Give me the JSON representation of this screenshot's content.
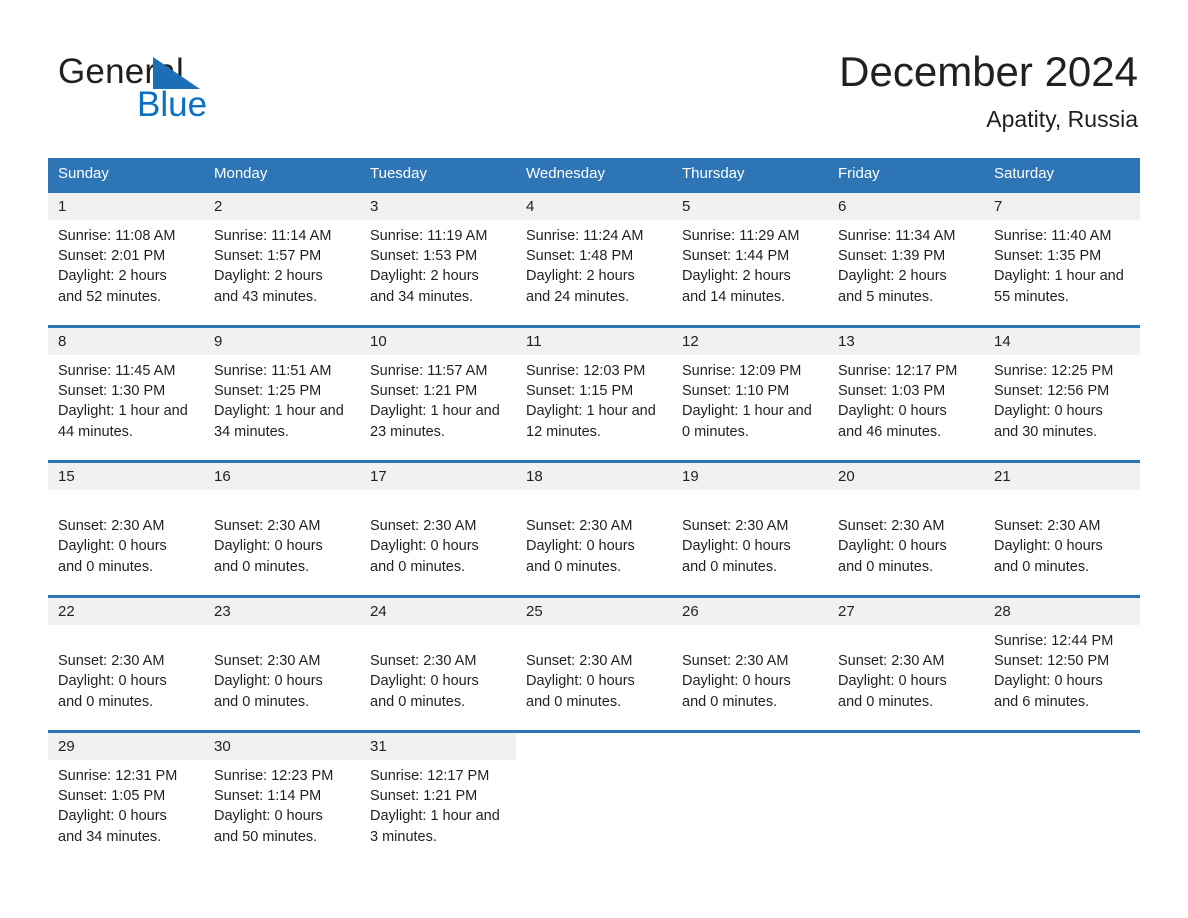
{
  "brand": {
    "name_part1": "General",
    "name_part2": "Blue",
    "triangle_color": "#1a6fb5",
    "blue_text_color": "#0c71c3"
  },
  "header": {
    "title": "December 2024",
    "location": "Apatity, Russia"
  },
  "calendar": {
    "header_bg": "#2e75b6",
    "daynum_bg": "#f1f1f1",
    "weekdays": [
      "Sunday",
      "Monday",
      "Tuesday",
      "Wednesday",
      "Thursday",
      "Friday",
      "Saturday"
    ],
    "weeks": [
      [
        {
          "day": "1",
          "lines": [
            "Sunrise: 11:08 AM",
            "Sunset: 2:01 PM",
            "Daylight: 2 hours",
            "and 52 minutes."
          ]
        },
        {
          "day": "2",
          "lines": [
            "Sunrise: 11:14 AM",
            "Sunset: 1:57 PM",
            "Daylight: 2 hours",
            "and 43 minutes."
          ]
        },
        {
          "day": "3",
          "lines": [
            "Sunrise: 11:19 AM",
            "Sunset: 1:53 PM",
            "Daylight: 2 hours",
            "and 34 minutes."
          ]
        },
        {
          "day": "4",
          "lines": [
            "Sunrise: 11:24 AM",
            "Sunset: 1:48 PM",
            "Daylight: 2 hours",
            "and 24 minutes."
          ]
        },
        {
          "day": "5",
          "lines": [
            "Sunrise: 11:29 AM",
            "Sunset: 1:44 PM",
            "Daylight: 2 hours",
            "and 14 minutes."
          ]
        },
        {
          "day": "6",
          "lines": [
            "Sunrise: 11:34 AM",
            "Sunset: 1:39 PM",
            "Daylight: 2 hours",
            "and 5 minutes."
          ]
        },
        {
          "day": "7",
          "lines": [
            "Sunrise: 11:40 AM",
            "Sunset: 1:35 PM",
            "Daylight: 1 hour and",
            "55 minutes."
          ]
        }
      ],
      [
        {
          "day": "8",
          "lines": [
            "Sunrise: 11:45 AM",
            "Sunset: 1:30 PM",
            "Daylight: 1 hour and",
            "44 minutes."
          ]
        },
        {
          "day": "9",
          "lines": [
            "Sunrise: 11:51 AM",
            "Sunset: 1:25 PM",
            "Daylight: 1 hour and",
            "34 minutes."
          ]
        },
        {
          "day": "10",
          "lines": [
            "Sunrise: 11:57 AM",
            "Sunset: 1:21 PM",
            "Daylight: 1 hour and",
            "23 minutes."
          ]
        },
        {
          "day": "11",
          "lines": [
            "Sunrise: 12:03 PM",
            "Sunset: 1:15 PM",
            "Daylight: 1 hour and",
            "12 minutes."
          ]
        },
        {
          "day": "12",
          "lines": [
            "Sunrise: 12:09 PM",
            "Sunset: 1:10 PM",
            "Daylight: 1 hour and",
            "0 minutes."
          ]
        },
        {
          "day": "13",
          "lines": [
            "Sunrise: 12:17 PM",
            "Sunset: 1:03 PM",
            "Daylight: 0 hours",
            "and 46 minutes."
          ]
        },
        {
          "day": "14",
          "lines": [
            "Sunrise: 12:25 PM",
            "Sunset: 12:56 PM",
            "Daylight: 0 hours",
            "and 30 minutes."
          ]
        }
      ],
      [
        {
          "day": "15",
          "lines": [
            "",
            "Sunset: 2:30 AM",
            "Daylight: 0 hours",
            "and 0 minutes."
          ]
        },
        {
          "day": "16",
          "lines": [
            "",
            "Sunset: 2:30 AM",
            "Daylight: 0 hours",
            "and 0 minutes."
          ]
        },
        {
          "day": "17",
          "lines": [
            "",
            "Sunset: 2:30 AM",
            "Daylight: 0 hours",
            "and 0 minutes."
          ]
        },
        {
          "day": "18",
          "lines": [
            "",
            "Sunset: 2:30 AM",
            "Daylight: 0 hours",
            "and 0 minutes."
          ]
        },
        {
          "day": "19",
          "lines": [
            "",
            "Sunset: 2:30 AM",
            "Daylight: 0 hours",
            "and 0 minutes."
          ]
        },
        {
          "day": "20",
          "lines": [
            "",
            "Sunset: 2:30 AM",
            "Daylight: 0 hours",
            "and 0 minutes."
          ]
        },
        {
          "day": "21",
          "lines": [
            "",
            "Sunset: 2:30 AM",
            "Daylight: 0 hours",
            "and 0 minutes."
          ]
        }
      ],
      [
        {
          "day": "22",
          "lines": [
            "",
            "Sunset: 2:30 AM",
            "Daylight: 0 hours",
            "and 0 minutes."
          ]
        },
        {
          "day": "23",
          "lines": [
            "",
            "Sunset: 2:30 AM",
            "Daylight: 0 hours",
            "and 0 minutes."
          ]
        },
        {
          "day": "24",
          "lines": [
            "",
            "Sunset: 2:30 AM",
            "Daylight: 0 hours",
            "and 0 minutes."
          ]
        },
        {
          "day": "25",
          "lines": [
            "",
            "Sunset: 2:30 AM",
            "Daylight: 0 hours",
            "and 0 minutes."
          ]
        },
        {
          "day": "26",
          "lines": [
            "",
            "Sunset: 2:30 AM",
            "Daylight: 0 hours",
            "and 0 minutes."
          ]
        },
        {
          "day": "27",
          "lines": [
            "",
            "Sunset: 2:30 AM",
            "Daylight: 0 hours",
            "and 0 minutes."
          ]
        },
        {
          "day": "28",
          "lines": [
            "Sunrise: 12:44 PM",
            "Sunset: 12:50 PM",
            "Daylight: 0 hours",
            "and 6 minutes."
          ]
        }
      ],
      [
        {
          "day": "29",
          "lines": [
            "Sunrise: 12:31 PM",
            "Sunset: 1:05 PM",
            "Daylight: 0 hours",
            "and 34 minutes."
          ]
        },
        {
          "day": "30",
          "lines": [
            "Sunrise: 12:23 PM",
            "Sunset: 1:14 PM",
            "Daylight: 0 hours",
            "and 50 minutes."
          ]
        },
        {
          "day": "31",
          "lines": [
            "Sunrise: 12:17 PM",
            "Sunset: 1:21 PM",
            "Daylight: 1 hour and",
            "3 minutes."
          ]
        },
        {
          "day": "",
          "lines": []
        },
        {
          "day": "",
          "lines": []
        },
        {
          "day": "",
          "lines": []
        },
        {
          "day": "",
          "lines": []
        }
      ]
    ]
  }
}
